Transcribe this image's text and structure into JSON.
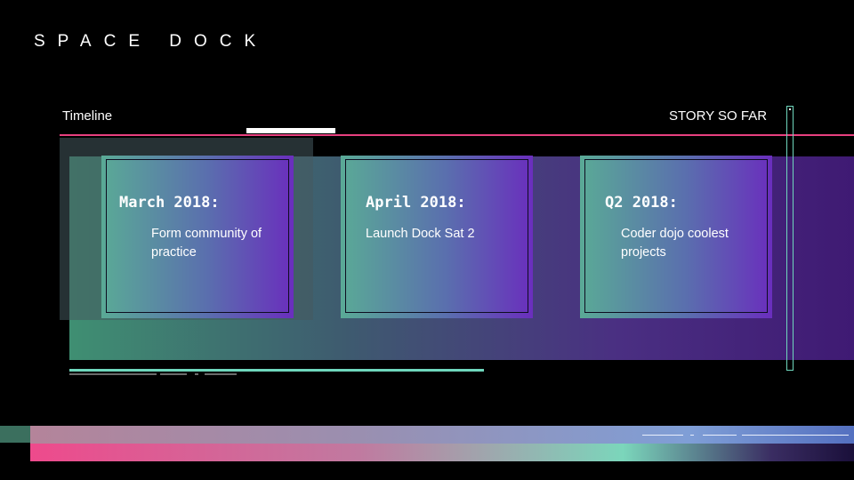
{
  "header": {
    "logo_text": "SPACE DOCK"
  },
  "section": {
    "left_label": "Timeline",
    "right_label": "STORY SO FAR"
  },
  "timeline": {
    "items": [
      {
        "date": "March 2018:",
        "description": "Form community of practice"
      },
      {
        "date": "April 2018:",
        "description": "Launch Dock Sat 2"
      },
      {
        "date": "Q2 2018:",
        "description": "Coder dojo coolest projects"
      }
    ]
  },
  "colors": {
    "accent_pink": "#e8407f",
    "accent_mint": "#6fd7bd",
    "card_start": "#5aaa96",
    "card_end": "#6a2ebd",
    "background": "#000000"
  }
}
